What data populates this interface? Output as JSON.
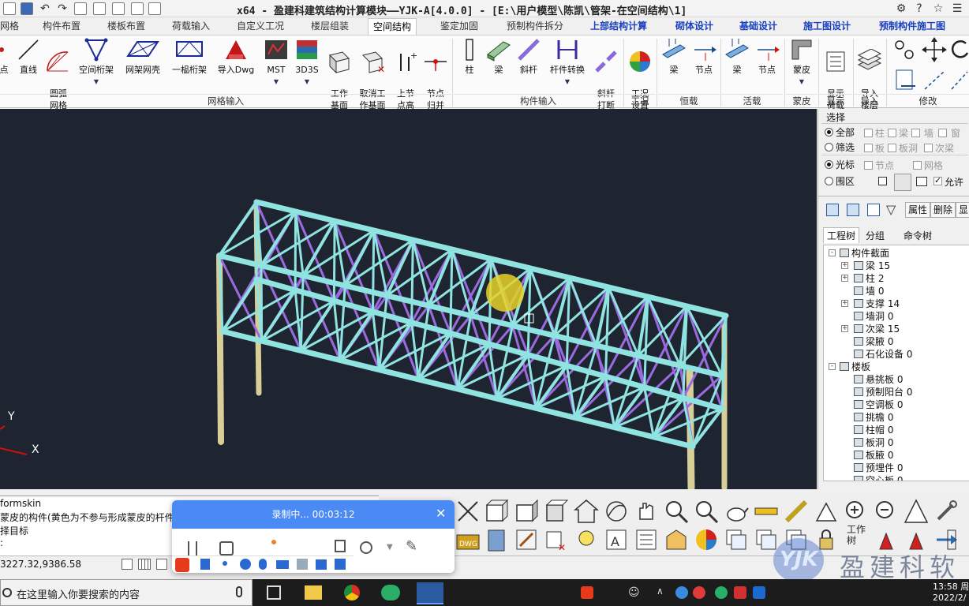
{
  "window": {
    "title": "x64 - 盈建科建筑结构计算模块——YJK-A[4.0.0] - [E:\\用户模型\\陈凯\\管架-在空间结构\\1]"
  },
  "ribbon": {
    "tabs": [
      "网格",
      "构件布置",
      "楼板布置",
      "荷载输入",
      "自定义工况",
      "楼层组装",
      "空间结构",
      "鉴定加固",
      "预制构件拆分",
      "上部结构计算",
      "砌体设计",
      "基础设计",
      "施工图设计",
      "预制构件施工图"
    ],
    "active_tab": "空间结构",
    "buttons": {
      "point": "点",
      "line": "直线",
      "arc_grid": "圆弧\n网格",
      "space_truss": "空间桁架",
      "grid_shell": "网架网壳",
      "single_truss": "一榀桁架",
      "import_dwg": "导入Dwg",
      "mst": "MST",
      "d3s": "3D3S",
      "work_plane": "工作\n基面",
      "cancel_work_plane": "取消工\n作基面",
      "node_up": "上节\n点高",
      "node_merge": "节点\n归并",
      "column": "柱",
      "beam": "梁",
      "brace": "斜杆",
      "member_convert": "杆件转换",
      "brace_break": "斜杆\n打断",
      "case_setting": "工况\n设置",
      "const_beam": "梁",
      "const_node": "节点",
      "live_beam": "梁",
      "live_node": "节点",
      "skin": "蒙皮",
      "display_load": "显示\n荷载",
      "import_floor": "导入\n楼层"
    },
    "groups": {
      "grid_input": "网格输入",
      "member_input": "构件输入",
      "cases": "工况",
      "constant_load": "恒载",
      "live_load": "活载",
      "skin": "蒙皮",
      "display": "显示",
      "import": "导入",
      "modify": "修改"
    }
  },
  "panel": {
    "select_title": "选择",
    "radio_all": "全部",
    "radio_filter": "筛选",
    "radio_cursor": "光标",
    "radio_region": "围区",
    "chk_column": "柱",
    "chk_beam": "梁",
    "chk_wall": "墙",
    "chk_window": "窗",
    "chk_slab": "板",
    "chk_slab_hole": "板洞",
    "chk_sec_beam": "次梁",
    "chk_node": "节点",
    "chk_grid": "网格",
    "allow_label": "允许",
    "prop_button": "属性",
    "delete_button": "删除",
    "display_button": "显",
    "tabs": [
      "工程树",
      "分组",
      "命令树"
    ],
    "tree": [
      {
        "label": "构件截面",
        "level": 0,
        "pm": "-"
      },
      {
        "label": "梁  15",
        "level": 1,
        "pm": "+"
      },
      {
        "label": "柱  2",
        "level": 1,
        "pm": "+"
      },
      {
        "label": "墙  0",
        "level": 1,
        "pm": ""
      },
      {
        "label": "支撑  14",
        "level": 1,
        "pm": "+"
      },
      {
        "label": "墙洞  0",
        "level": 1,
        "pm": ""
      },
      {
        "label": "次梁  15",
        "level": 1,
        "pm": "+"
      },
      {
        "label": "梁腋  0",
        "level": 1,
        "pm": ""
      },
      {
        "label": "石化设备  0",
        "level": 1,
        "pm": ""
      },
      {
        "label": "楼板",
        "level": 0,
        "pm": "-"
      },
      {
        "label": "悬挑板  0",
        "level": 1,
        "pm": ""
      },
      {
        "label": "预制阳台  0",
        "level": 1,
        "pm": ""
      },
      {
        "label": "空调板  0",
        "level": 1,
        "pm": ""
      },
      {
        "label": "挑檐  0",
        "level": 1,
        "pm": ""
      },
      {
        "label": "柱帽  0",
        "level": 1,
        "pm": ""
      },
      {
        "label": "板洞  0",
        "level": 1,
        "pm": ""
      },
      {
        "label": "板腋  0",
        "level": 1,
        "pm": ""
      },
      {
        "label": "预埋件  0",
        "level": 1,
        "pm": ""
      },
      {
        "label": "空心板  0",
        "level": 1,
        "pm": ""
      }
    ]
  },
  "viewport": {
    "axis_y": "Y",
    "axis_x": "X"
  },
  "command": {
    "lines": [
      "formskin",
      "蒙皮的构件(黄色为不参与形成蒙皮的杆件",
      "择目标",
      ":"
    ],
    "coords": "3227.32,9386.58"
  },
  "recording": {
    "title": "录制中... 00:03:12"
  },
  "taskbar": {
    "search_placeholder": "在这里输入你要搜索的内容",
    "time": "13:58 周",
    "date": "2022/2/"
  },
  "watermark": {
    "brand": "YJK",
    "text": "盈建科软"
  },
  "bottom_toolbar": {
    "work_label": "工作\n树"
  }
}
